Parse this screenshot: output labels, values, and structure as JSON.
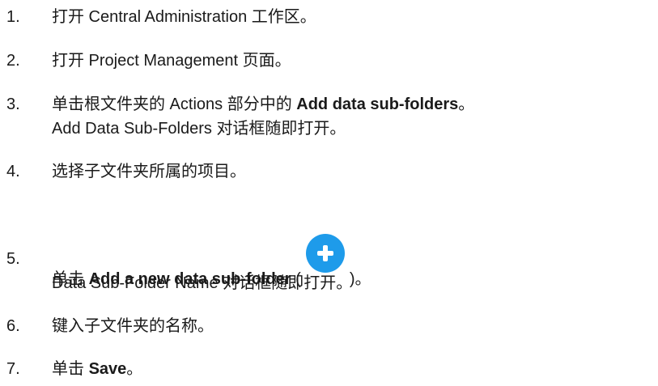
{
  "steps": [
    {
      "number": "1.",
      "text_before": "打开 Central Administration 工作区。"
    },
    {
      "number": "2.",
      "text_before": "打开 Project Management 页面。"
    },
    {
      "number": "3.",
      "text_before": "单击根文件夹的 Actions 部分中的 ",
      "bold": "Add data sub-folders",
      "text_after": "。",
      "line2": "Add Data Sub-Folders 对话框随即打开。"
    },
    {
      "number": "4.",
      "text_before": "选择子文件夹所属的项目。"
    },
    {
      "number": "5.",
      "text_before": "单击 ",
      "bold": "Add a new data sub-folder",
      "text_mid": " (",
      "icon": "add-circle-icon",
      "text_after": ")。",
      "line2": "Data Sub-Folder Name 对话框随即打开。"
    },
    {
      "number": "6.",
      "text_before": "键入子文件夹的名称。"
    },
    {
      "number": "7.",
      "text_before": "单击 ",
      "bold": "Save",
      "text_after": "。"
    }
  ],
  "colors": {
    "text": "#1a1a1a",
    "icon_bg": "#1e9bea",
    "icon_fg": "#ffffff"
  }
}
